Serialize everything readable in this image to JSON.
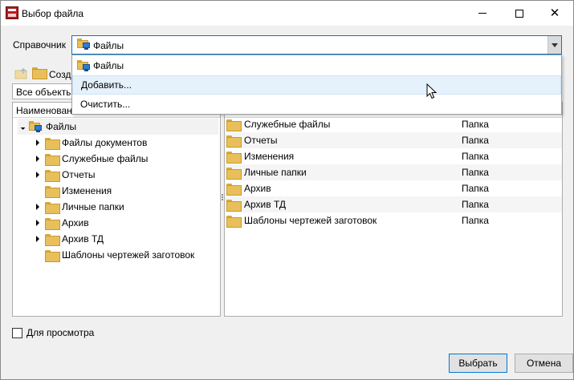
{
  "window": {
    "title": "Выбор файла"
  },
  "window_controls": {
    "minimize": "minimize-icon",
    "maximize": "maximize-icon",
    "close": "✕"
  },
  "catalog": {
    "label": "Справочник",
    "selected": "Файлы"
  },
  "dropdown": {
    "items": [
      "Файлы",
      "Добавить...",
      "Очистить..."
    ],
    "highlighted_index": 1
  },
  "toolbar": {
    "create_label": "Созда"
  },
  "filter": {
    "value": "Все объекты"
  },
  "tree": {
    "header": "Наименован",
    "root": "Файлы",
    "children": [
      {
        "label": "Файлы документов",
        "expandable": true
      },
      {
        "label": "Служебные файлы",
        "expandable": true
      },
      {
        "label": "Отчеты",
        "expandable": true
      },
      {
        "label": "Изменения",
        "expandable": false
      },
      {
        "label": "Личные папки",
        "expandable": true
      },
      {
        "label": "Архив",
        "expandable": true
      },
      {
        "label": "Архив ТД",
        "expandable": true
      },
      {
        "label": "Шаблоны чертежей заготовок",
        "expandable": false
      }
    ]
  },
  "list": {
    "rows": [
      {
        "name": "Служебные файлы",
        "type": "Папка"
      },
      {
        "name": "Отчеты",
        "type": "Папка"
      },
      {
        "name": "Изменения",
        "type": "Папка"
      },
      {
        "name": "Личные папки",
        "type": "Папка"
      },
      {
        "name": "Архив",
        "type": "Папка"
      },
      {
        "name": "Архив ТД",
        "type": "Папка"
      },
      {
        "name": "Шаблоны чертежей заготовок",
        "type": "Папка"
      }
    ]
  },
  "preview": {
    "label": "Для просмотра",
    "checked": false
  },
  "buttons": {
    "ok": "Выбрать",
    "cancel": "Отмена"
  }
}
